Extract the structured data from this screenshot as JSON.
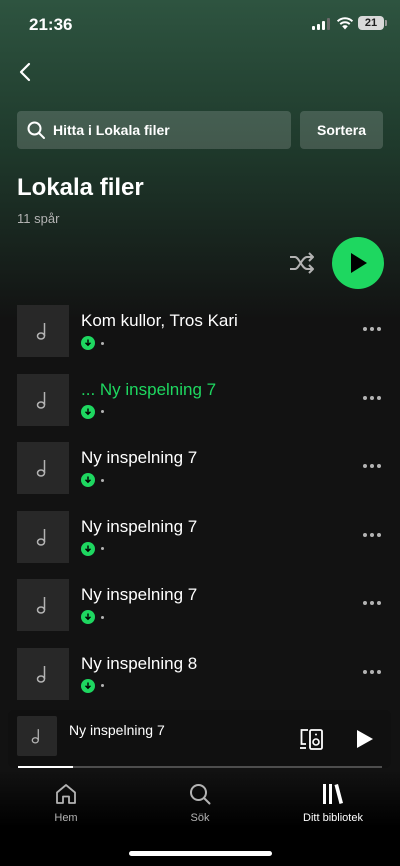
{
  "status": {
    "time": "21:36",
    "battery": "21"
  },
  "search": {
    "placeholder": "Hitta i Lokala filer",
    "sort_label": "Sortera"
  },
  "header": {
    "title": "Lokala filer",
    "track_count": "11 spår"
  },
  "tracks": [
    {
      "title": "Kom kullor, Tros Kari",
      "active": false
    },
    {
      "title": "... Ny inspelning 7",
      "active": true
    },
    {
      "title": "Ny inspelning 7",
      "active": false
    },
    {
      "title": "Ny inspelning 7",
      "active": false
    },
    {
      "title": "Ny inspelning 7",
      "active": false
    },
    {
      "title": "Ny inspelning 8",
      "active": false
    }
  ],
  "now_playing": {
    "title": "Ny inspelning 7",
    "progress": 0.15
  },
  "nav": {
    "home": "Hem",
    "search": "Sök",
    "library": "Ditt bibliotek"
  },
  "colors": {
    "accent": "#1ed760",
    "background": "#121212",
    "header_gradient": "#2e5440"
  },
  "icons": {
    "back": "chevron-left-icon",
    "search": "search-icon",
    "shuffle": "shuffle-icon",
    "play": "play-icon",
    "track_art": "music-note-icon",
    "downloaded": "download-icon",
    "more": "more-icon",
    "devices": "devices-icon",
    "home": "home-icon",
    "library": "library-icon"
  }
}
